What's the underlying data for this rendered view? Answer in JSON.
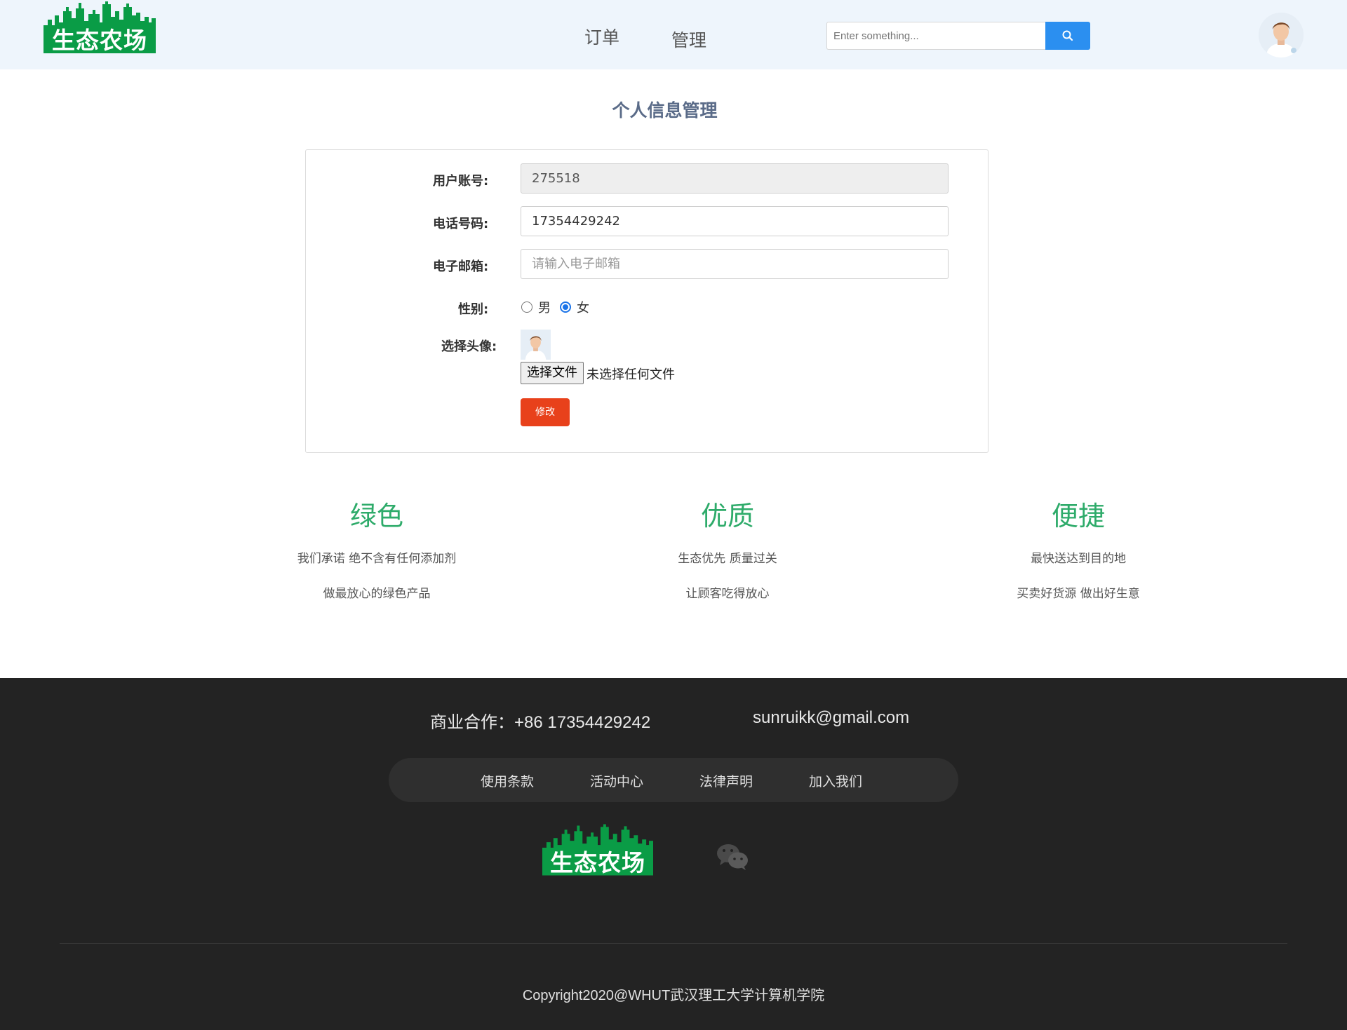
{
  "brand": {
    "logo_text": "生态农场",
    "logo_color": "#0a9c46"
  },
  "nav": {
    "items": [
      {
        "label": "订单"
      },
      {
        "label": "管理"
      }
    ]
  },
  "search": {
    "placeholder": "Enter something...",
    "button_icon": "search-icon",
    "button_color": "#2b8ff0"
  },
  "user": {
    "avatar_icon": "user-avatar-icon"
  },
  "page": {
    "title": "个人信息管理"
  },
  "form": {
    "account": {
      "label": "用户账号:",
      "value": "275518"
    },
    "phone": {
      "label": "电话号码:",
      "value": "17354429242"
    },
    "email": {
      "label": "电子邮箱:",
      "value": "",
      "placeholder": "请输入电子邮箱"
    },
    "gender": {
      "label": "性别:",
      "options": [
        {
          "label": "男",
          "checked": false
        },
        {
          "label": "女",
          "checked": true
        }
      ]
    },
    "avatar": {
      "label": "选择头像:",
      "file_button": "选择文件",
      "file_status": "未选择任何文件"
    },
    "submit": {
      "label": "修改",
      "color": "#e8411b"
    }
  },
  "features": [
    {
      "title": "绿色",
      "lines": [
        "我们承诺 绝不含有任何添加剂",
        "做最放心的绿色产品"
      ]
    },
    {
      "title": "优质",
      "lines": [
        "生态优先 质量过关",
        "让顾客吃得放心"
      ]
    },
    {
      "title": "便捷",
      "lines": [
        "最快送达到目的地",
        "买卖好货源 做出好生意"
      ]
    }
  ],
  "feature_color": "#2eab6a",
  "footer": {
    "contact_phone": "商业合作：+86 17354429242",
    "contact_email": "sunruikk@gmail.com",
    "links": [
      {
        "label": "使用条款"
      },
      {
        "label": "活动中心"
      },
      {
        "label": "法律声明"
      },
      {
        "label": "加入我们"
      }
    ],
    "logo_text": "生态农场",
    "social_icon": "wechat-icon",
    "copyright": "Copyright2020@WHUT武汉理工大学计算机学院",
    "background": "#232323"
  }
}
